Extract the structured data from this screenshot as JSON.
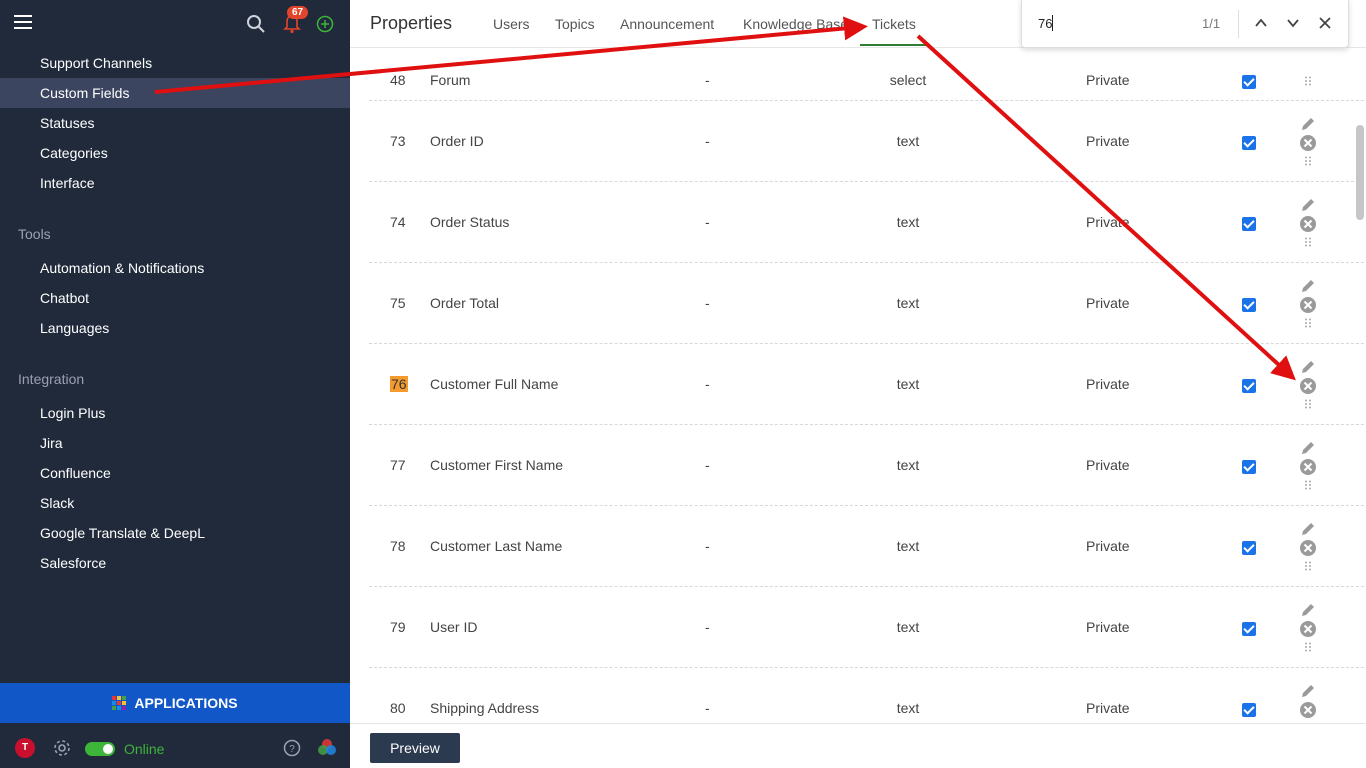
{
  "sidebar": {
    "items": [
      {
        "label": "Support Channels",
        "active": false
      },
      {
        "label": "Custom Fields",
        "active": true
      },
      {
        "label": "Statuses",
        "active": false
      },
      {
        "label": "Categories",
        "active": false
      },
      {
        "label": "Interface",
        "active": false
      }
    ],
    "tools_heading": "Tools",
    "tools": [
      "Automation & Notifications",
      "Chatbot",
      "Languages"
    ],
    "integration_heading": "Integration",
    "integration": [
      "Login Plus",
      "Jira",
      "Confluence",
      "Slack",
      "Google Translate & DeepL",
      "Salesforce"
    ],
    "notification_count": "67",
    "applications_label": "APPLICATIONS",
    "avatar_letter": "T",
    "status_label": "Online"
  },
  "header": {
    "title": "Properties",
    "tabs": [
      "Users",
      "Topics",
      "Announcement",
      "Knowledge Base",
      "Tickets"
    ]
  },
  "find": {
    "query": "76",
    "count": "1/1"
  },
  "rows": [
    {
      "id": "48",
      "name": "Forum",
      "description": "-",
      "type": "select",
      "visibility": "Private"
    },
    {
      "id": "73",
      "name": "Order ID",
      "description": "-",
      "type": "text",
      "visibility": "Private"
    },
    {
      "id": "74",
      "name": "Order Status",
      "description": "-",
      "type": "text",
      "visibility": "Private"
    },
    {
      "id": "75",
      "name": "Order Total",
      "description": "-",
      "type": "text",
      "visibility": "Private"
    },
    {
      "id": "76",
      "name": "Customer Full Name",
      "description": "-",
      "type": "text",
      "visibility": "Private"
    },
    {
      "id": "77",
      "name": "Customer First Name",
      "description": "-",
      "type": "text",
      "visibility": "Private"
    },
    {
      "id": "78",
      "name": "Customer Last Name",
      "description": "-",
      "type": "text",
      "visibility": "Private"
    },
    {
      "id": "79",
      "name": "User ID",
      "description": "-",
      "type": "text",
      "visibility": "Private"
    },
    {
      "id": "80",
      "name": "Shipping Address",
      "description": "-",
      "type": "text",
      "visibility": "Private"
    }
  ],
  "footer": {
    "preview_label": "Preview"
  },
  "colors": {
    "sidebar_bg": "#212a3b",
    "active_item_bg": "#3b4560",
    "applications_bg": "#1257c8",
    "online_green": "#3db43a",
    "checkbox_blue": "#1a73e8",
    "search_highlight": "#f59a2f",
    "annotation_arrow": "#e01010"
  }
}
